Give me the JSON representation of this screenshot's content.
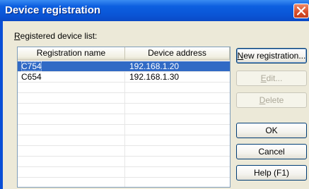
{
  "dialog": {
    "title": "Device registration"
  },
  "list": {
    "label_mnemonic": "R",
    "label_rest": "egistered device list:",
    "columns": [
      "Registration name",
      "Device address"
    ],
    "rows": [
      {
        "name": "C754",
        "address": "192.168.1.20",
        "selected": true
      },
      {
        "name": "C654",
        "address": "192.168.1.30",
        "selected": false
      }
    ]
  },
  "buttons": {
    "new_mn": "N",
    "new_rest": "ew registration...",
    "edit_mn": "E",
    "edit_rest": "dit...",
    "delete_mn": "D",
    "delete_rest": "elete",
    "ok": "OK",
    "cancel": "Cancel",
    "help": "Help (F1)"
  },
  "colors": {
    "titlebar": "#0a55d6",
    "selection": "#316ac5",
    "close_button": "#d9502c"
  },
  "icons": {
    "close": "close-icon"
  }
}
